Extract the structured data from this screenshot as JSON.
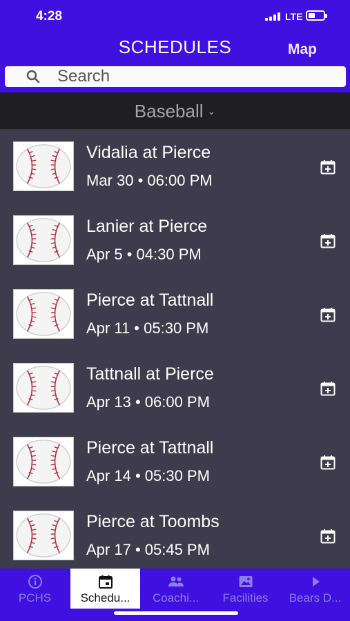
{
  "status_bar": {
    "time": "4:28",
    "network": "LTE"
  },
  "header": {
    "title": "SCHEDULES",
    "map_label": "Map"
  },
  "search": {
    "placeholder": "Search"
  },
  "filter": {
    "selected": "Baseball"
  },
  "games": [
    {
      "title": "Vidalia at Pierce",
      "date": "Mar 30",
      "time": "06:00 PM"
    },
    {
      "title": "Lanier at Pierce",
      "date": "Apr 5",
      "time": "04:30 PM"
    },
    {
      "title": "Pierce at Tattnall",
      "date": "Apr 11",
      "time": "05:30 PM"
    },
    {
      "title": "Tattnall at Pierce",
      "date": "Apr 13",
      "time": "06:00 PM"
    },
    {
      "title": "Pierce at Tattnall",
      "date": "Apr 14",
      "time": "05:30 PM"
    },
    {
      "title": "Pierce at Toombs",
      "date": "Apr 17",
      "time": "05:45 PM"
    }
  ],
  "tabs": [
    {
      "label": "PCHS",
      "icon": "info-icon",
      "active": false
    },
    {
      "label": "Schedu...",
      "icon": "calendar-icon",
      "active": true
    },
    {
      "label": "Coachi...",
      "icon": "people-icon",
      "active": false
    },
    {
      "label": "Facilities",
      "icon": "image-icon",
      "active": false
    },
    {
      "label": "Bears D...",
      "icon": "play-icon",
      "active": false
    }
  ],
  "colors": {
    "header_bg": "#3f10e0",
    "list_bg": "#3d3b4c",
    "filter_bg": "#1f1f21",
    "inactive_tab": "#8b7fe8"
  }
}
